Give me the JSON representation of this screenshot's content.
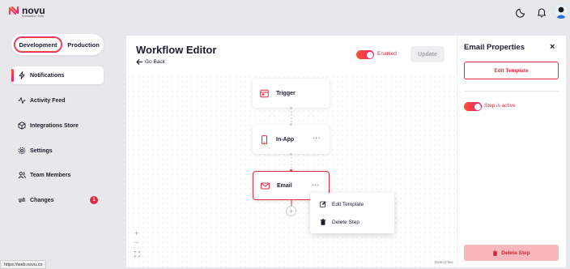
{
  "brand": {
    "name": "novu",
    "tagline": "Notification Infra",
    "accent_from": "#ff512f",
    "accent_to": "#dd2476"
  },
  "topbar": {
    "theme_icon": "moon-icon",
    "bell_icon": "bell-icon",
    "avatar_icon": "avatar"
  },
  "env": {
    "development": "Development",
    "production": "Production",
    "selected": "Development"
  },
  "sidebar": {
    "items": [
      {
        "label": "Notifications",
        "icon": "lightning-icon",
        "active": true
      },
      {
        "label": "Activity Feed",
        "icon": "activity-icon",
        "active": false
      },
      {
        "label": "Integrations Store",
        "icon": "box-icon",
        "active": false
      },
      {
        "label": "Settings",
        "icon": "gear-icon",
        "active": false
      },
      {
        "label": "Team Members",
        "icon": "users-icon",
        "active": false
      },
      {
        "label": "Changes",
        "icon": "sync-icon",
        "active": false,
        "badge": "1"
      }
    ]
  },
  "editor": {
    "title": "Workflow Editor",
    "back_label": "Go Back",
    "enabled_label": "Enabled",
    "enabled": true,
    "update_label": "Update",
    "nodes": [
      {
        "label": "Trigger",
        "icon": "trigger-icon"
      },
      {
        "label": "In-App",
        "icon": "mobile-icon",
        "menu": "···"
      },
      {
        "label": "Email",
        "icon": "mail-icon",
        "menu": "···",
        "selected": true
      }
    ],
    "add_step": "+",
    "context_menu": [
      {
        "label": "Edit Template",
        "icon": "edit-icon"
      },
      {
        "label": "Delete Step",
        "icon": "trash-icon"
      }
    ],
    "zoom_in": "+",
    "zoom_out": "−",
    "fit_view": "fit-view-icon",
    "attribution": "React Flow"
  },
  "panel": {
    "title": "Email Properties",
    "close": "×",
    "edit_template_label": "Edit Template",
    "step_active_label": "Step is active",
    "step_active": true,
    "delete_step_label": "Delete Step"
  },
  "status_bar": {
    "url": "https://web.novu.co"
  },
  "colors": {
    "danger": "#e5283d",
    "background": "#e8e8ec",
    "text": "#1b1b2e"
  }
}
